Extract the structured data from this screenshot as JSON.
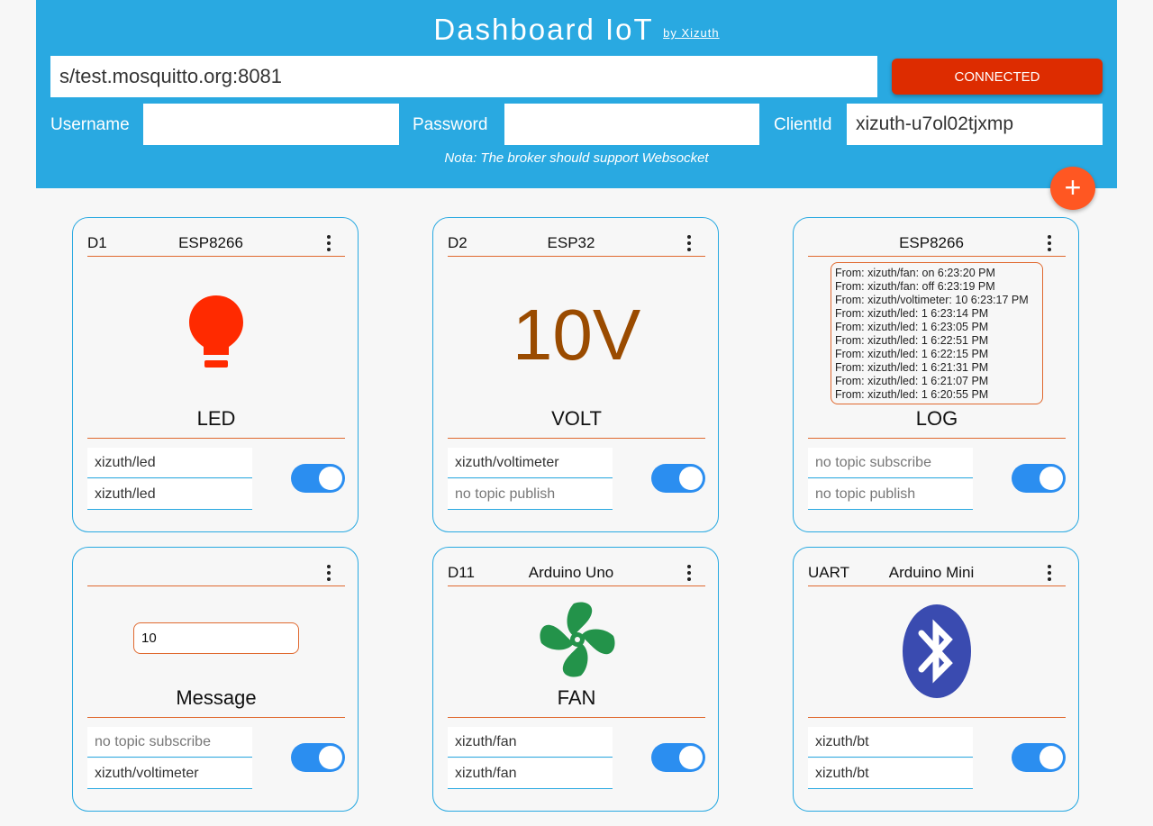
{
  "header": {
    "title": "Dashboard IoT",
    "byline": "by Xizuth",
    "broker_url": "s/test.mosquitto.org:8081",
    "connect_label": "CONNECTED",
    "username_label": "Username",
    "username_value": "",
    "password_label": "Password",
    "password_value": "",
    "clientid_label": "ClientId",
    "clientid_value": "xizuth-u7ol02tjxmp",
    "note": "Nota: The broker should support Websocket",
    "add_label": "+"
  },
  "colors": {
    "header_bg": "#29a9e1",
    "connected": "#dd2c00",
    "fab": "#ff5722",
    "accent_line": "#e0692f",
    "toggle_on": "#2b8ef0",
    "led": "#ff2a00",
    "volt": "#9a4b00",
    "fan": "#23934a",
    "bluetooth": "#3a4bb0"
  },
  "cards": [
    {
      "pin": "D1",
      "device": "ESP8266",
      "name": "LED",
      "icon": "bulb-icon",
      "subscribe": "xizuth/led",
      "publish": "xizuth/led",
      "enabled": true
    },
    {
      "pin": "D2",
      "device": "ESP32",
      "name": "VOLT",
      "value": "10V",
      "subscribe": "xizuth/voltimeter",
      "publish": "no topic publish",
      "enabled": true
    },
    {
      "pin": "",
      "device": "ESP8266",
      "name": "LOG",
      "subscribe": "no topic subscribe",
      "publish": "no topic publish",
      "enabled": true,
      "log": [
        "From: xizuth/fan: on       6:23:20 PM",
        "From: xizuth/fan: off      6:23:19 PM",
        "From: xizuth/voltimeter: 10    6:23:17 PM",
        "From: xizuth/led: 1  6:23:14 PM",
        "From: xizuth/led: 1  6:23:05 PM",
        "From: xizuth/led: 1  6:22:51 PM",
        "From: xizuth/led: 1  6:22:15 PM",
        "From: xizuth/led: 1  6:21:31 PM",
        "From: xizuth/led: 1  6:21:07 PM",
        "From: xizuth/led: 1  6:20:55 PM"
      ]
    },
    {
      "pin": "",
      "device": "",
      "name": "Message",
      "input_value": "10",
      "subscribe": "no topic subscribe",
      "publish": "xizuth/voltimeter",
      "enabled": true
    },
    {
      "pin": "D11",
      "device": "Arduino Uno",
      "name": "FAN",
      "icon": "fan-icon",
      "subscribe": "xizuth/fan",
      "publish": "xizuth/fan",
      "enabled": true
    },
    {
      "pin": "UART",
      "device": "Arduino Mini",
      "name": "",
      "icon": "bluetooth-icon",
      "subscribe": "xizuth/bt",
      "publish": "xizuth/bt",
      "enabled": true
    }
  ]
}
